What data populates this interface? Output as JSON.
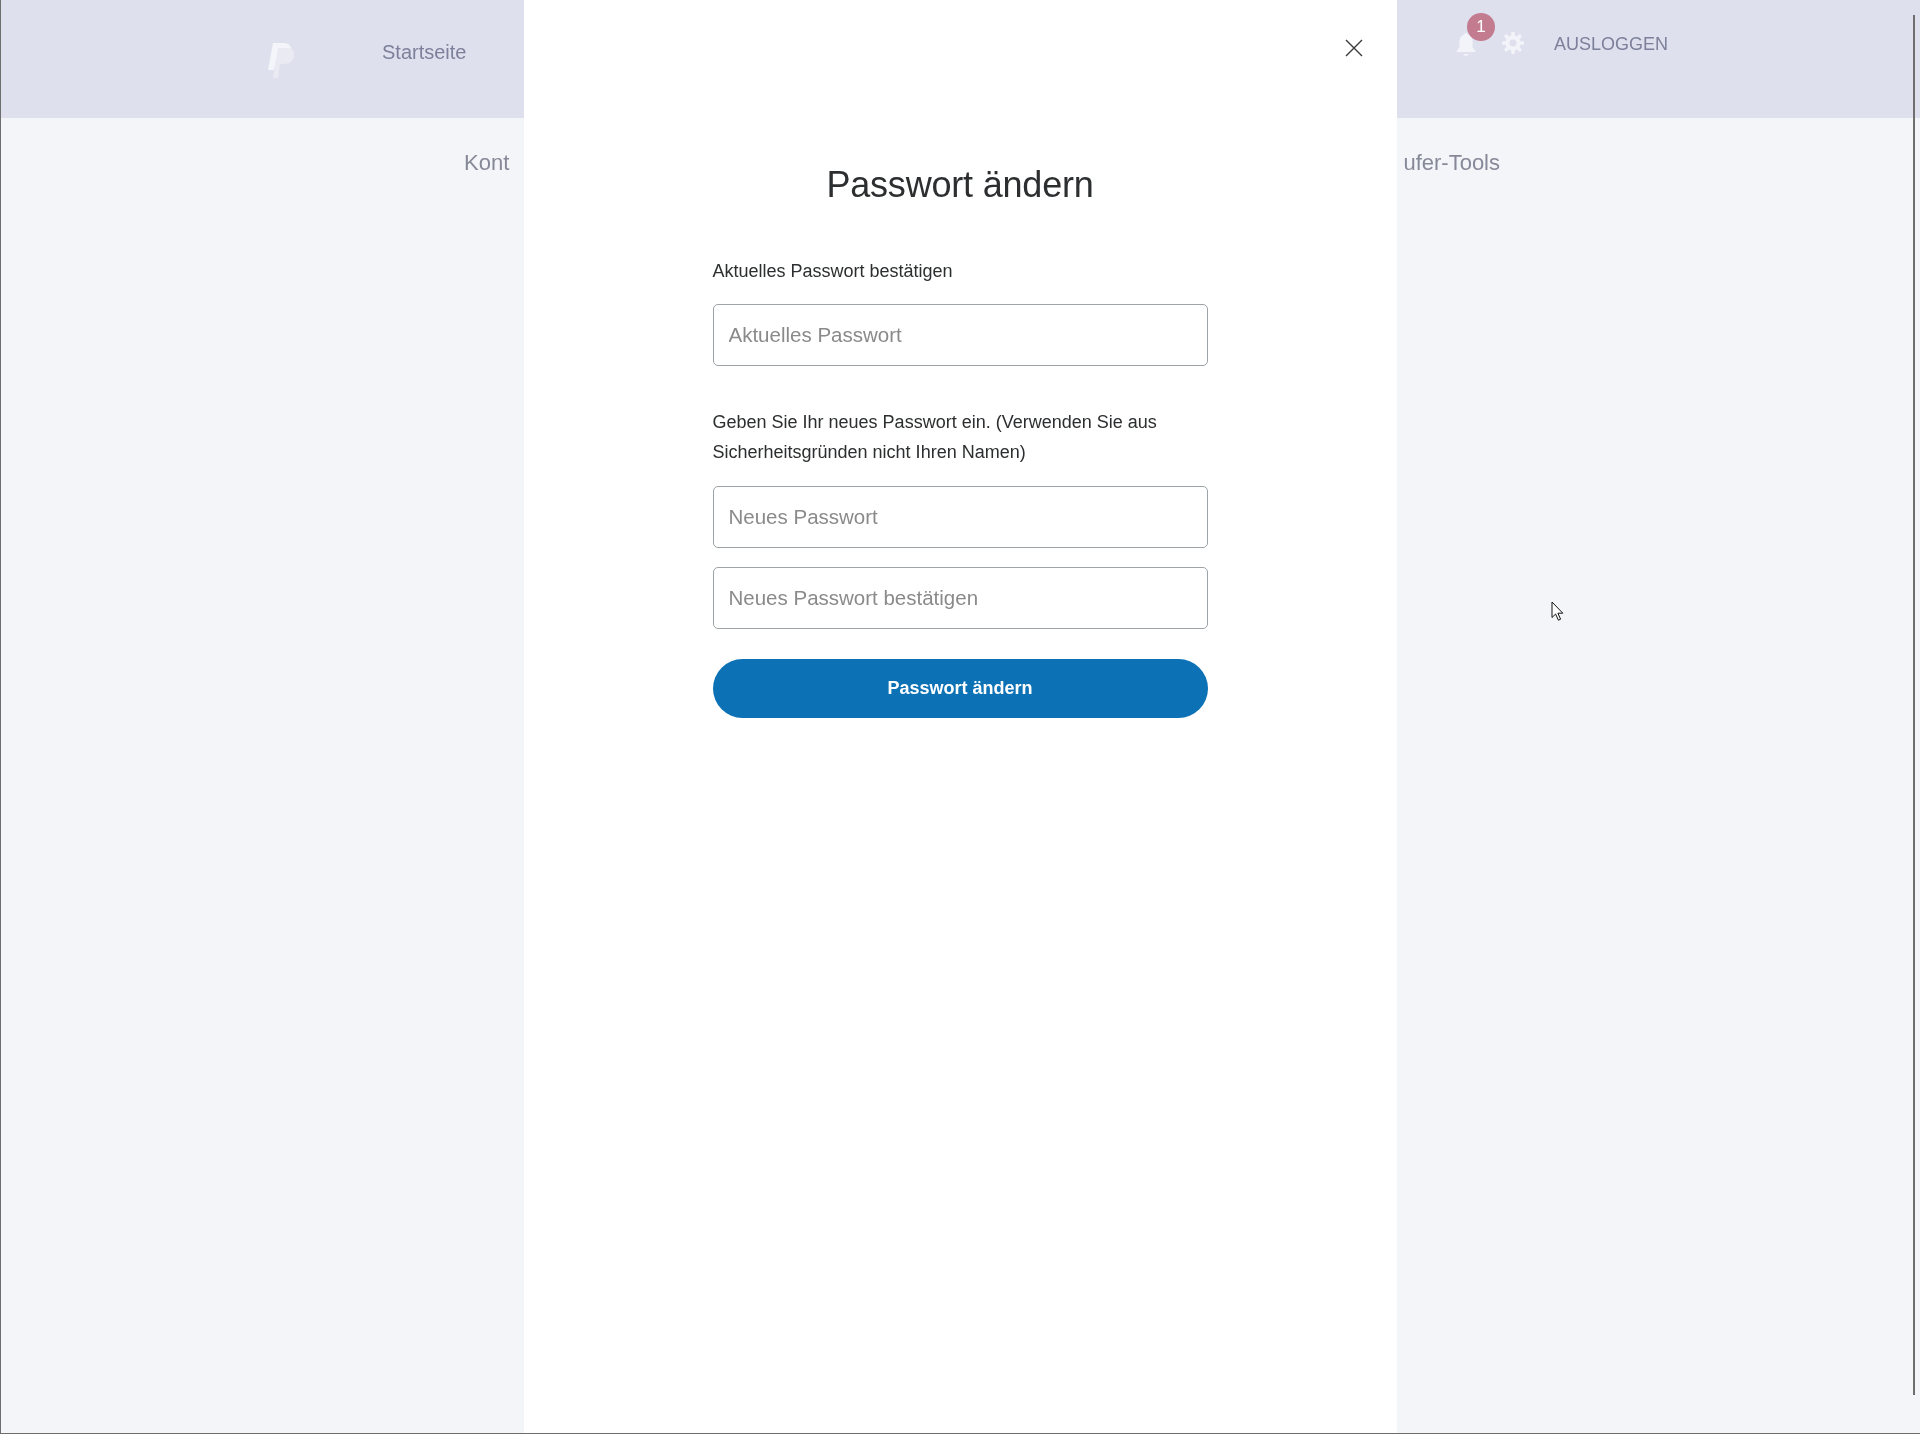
{
  "header": {
    "nav_items": [
      {
        "label": "Startseite"
      }
    ],
    "notification_count": "1",
    "logout": "AUSLOGGEN"
  },
  "subnav": {
    "items": [
      {
        "label": "Kont"
      },
      {
        "label": "ufer-Tools"
      }
    ]
  },
  "dialog": {
    "title": "Passwort ändern",
    "sections": [
      {
        "label": "Aktuelles Passwort bestätigen",
        "fields": [
          {
            "placeholder": "Aktuelles Passwort"
          }
        ]
      },
      {
        "label": "Geben Sie Ihr neues Passwort ein. (Verwenden Sie aus Sicherheitsgründen nicht Ihren Namen)",
        "fields": [
          {
            "placeholder": "Neues Passwort"
          },
          {
            "placeholder": "Neues Passwort bestätigen"
          }
        ]
      }
    ],
    "submit": "Passwort ändern"
  }
}
